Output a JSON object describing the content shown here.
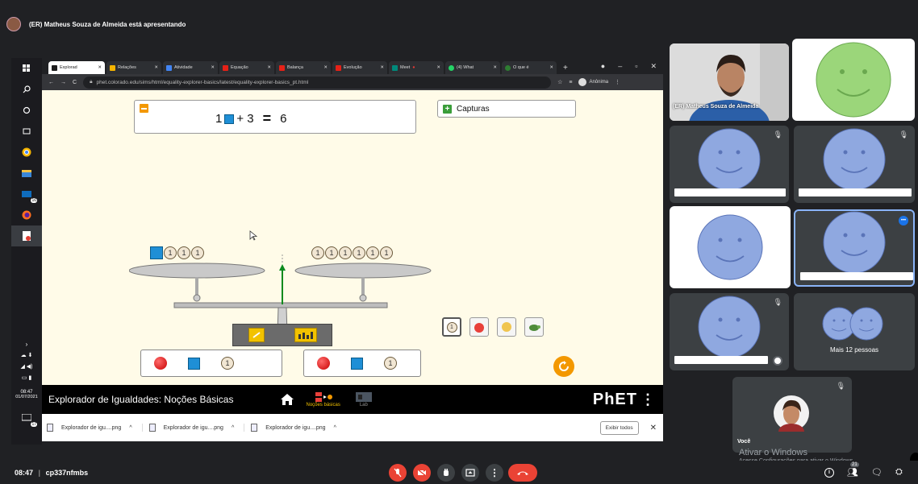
{
  "presenter_banner": "(ER) Matheus Souza de Almeida está apresentando",
  "browser": {
    "tabs": [
      "Explorad",
      "Relações",
      "Atividade",
      "Equação",
      "Balança",
      "Evolução",
      "Meet",
      "(4) What",
      "O que é"
    ],
    "new_tab": "+",
    "url": "phet.colorado.edu/sims/html/equality-explorer-basics/latest/equality-explorer-basics_pt.html",
    "profile": "Anônima"
  },
  "sim": {
    "equation": {
      "left_coef": "1",
      "left_const": "+ 3",
      "equals": "=",
      "right": "6"
    },
    "snapshots_label": "Capturas",
    "coin_label": "1",
    "title": "Explorador de Igualdades: Noções Básicas",
    "screen_basics": "Noções básicas",
    "screen_lab": "Lab",
    "phet_logo": "PhET"
  },
  "downloads": {
    "items": [
      "Explorador de igu....png",
      "Explorador de igu....png",
      "Explorador de igu....png"
    ],
    "show_all": "Exibir todos"
  },
  "taskbar": {
    "time": "08:47",
    "date": "01/07/2021",
    "badge": "16",
    "badge2": "17"
  },
  "participants": {
    "presenter_name": "(ER) Matheus Souza de Almeida",
    "more_label": "Mais 12 pessoas",
    "you_label": "Você"
  },
  "watermark": {
    "line1": "Ativar o Windows",
    "line2": "Acesse Configurações para ativar o Windows."
  },
  "meeting": {
    "time": "08:47",
    "code": "cp337nfmbs",
    "badge": "21"
  },
  "colors": {
    "meet_bg": "#202124",
    "phet_bg": "#fffbe8",
    "hangup": "#ea4335",
    "smiley_blue": "#8fa8e0",
    "smiley_green": "#9bd67a",
    "accent": "#8ab4f8"
  }
}
